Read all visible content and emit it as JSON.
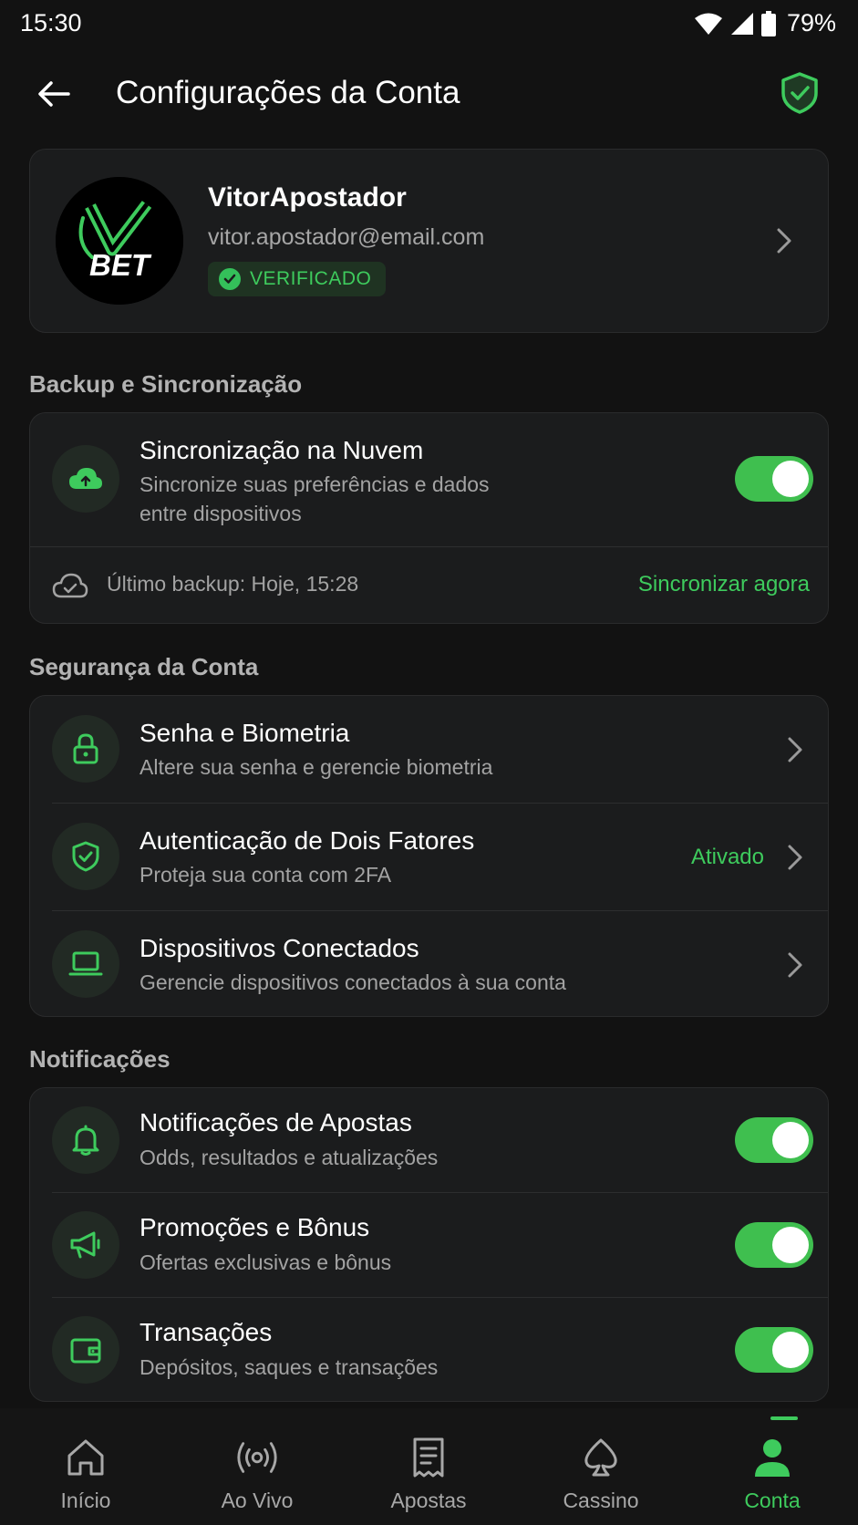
{
  "status_bar": {
    "time": "15:30",
    "battery": "79%"
  },
  "header": {
    "title": "Configurações da Conta"
  },
  "profile": {
    "name": "VitorApostador",
    "email": "vitor.apostador@email.com",
    "badge": "VERIFICADO",
    "logo_text": "BET"
  },
  "backup": {
    "section_title": "Backup e Sincronização",
    "cloud_sync": {
      "title": "Sincronização na Nuvem",
      "subtitle_line1": "Sincronize suas preferências e dados",
      "subtitle_line2": "entre dispositivos",
      "enabled": true
    },
    "last_backup": "Último backup: Hoje, 15:28",
    "sync_now": "Sincronizar agora"
  },
  "security": {
    "section_title": "Segurança da Conta",
    "items": [
      {
        "title": "Senha e Biometria",
        "subtitle": "Altere sua senha e gerencie biometria",
        "icon": "lock-icon"
      },
      {
        "title": "Autenticação de Dois Fatores",
        "subtitle": "Proteja sua conta com 2FA",
        "status": "Ativado",
        "icon": "shield-check-icon"
      },
      {
        "title": "Dispositivos Conectados",
        "subtitle": "Gerencie dispositivos conectados à sua conta",
        "icon": "laptop-icon"
      }
    ]
  },
  "notifications": {
    "section_title": "Notificações",
    "items": [
      {
        "title": "Notificações de Apostas",
        "subtitle": "Odds, resultados e atualizações",
        "icon": "bell-icon",
        "enabled": true
      },
      {
        "title": "Promoções e Bônus",
        "subtitle": "Ofertas exclusivas e bônus",
        "icon": "megaphone-icon",
        "enabled": true
      },
      {
        "title": "Transações",
        "subtitle": "Depósitos, saques e transações",
        "icon": "wallet-icon",
        "enabled": true
      }
    ]
  },
  "bottom_nav": {
    "items": [
      {
        "label": "Início",
        "icon": "home-icon"
      },
      {
        "label": "Ao Vivo",
        "icon": "live-icon"
      },
      {
        "label": "Apostas",
        "icon": "receipt-icon"
      },
      {
        "label": "Cassino",
        "icon": "spade-icon"
      },
      {
        "label": "Conta",
        "icon": "user-icon",
        "active": true
      }
    ]
  },
  "colors": {
    "accent": "#3ecb5d",
    "background": "#121212",
    "card": "#1b1c1d"
  }
}
